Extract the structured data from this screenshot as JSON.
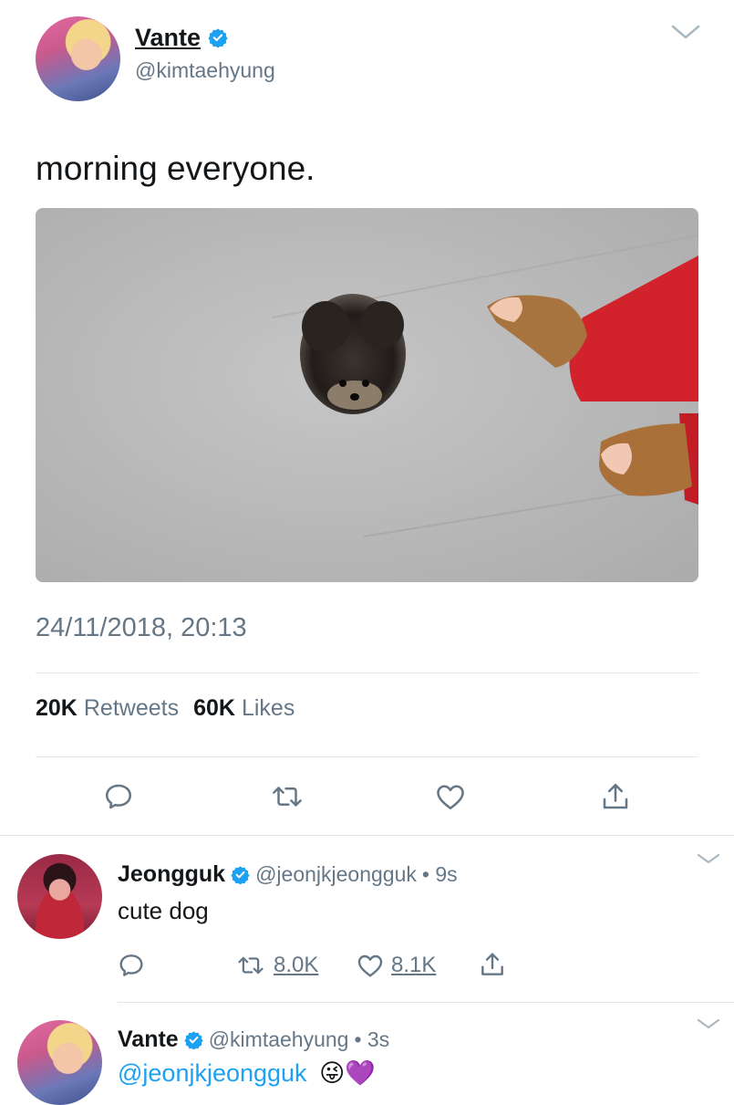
{
  "tweet": {
    "author_name": "Vante",
    "author_handle": "@kimtaehyung",
    "text": "morning everyone.",
    "timestamp": "24/11/2018, 20:13",
    "retweets_count": "20K",
    "retweets_label": "Retweets",
    "likes_count": "60K",
    "likes_label": "Likes"
  },
  "replies": [
    {
      "author_name": "Jeongguk",
      "author_handle": "@jeonjkjeongguk",
      "time": "• 9s",
      "text": "cute dog",
      "retweets": "8.0K",
      "likes": "8.1K"
    },
    {
      "author_name": "Vante",
      "author_handle": "@kimtaehyung",
      "time": "• 3s",
      "mention": "@jeonjkjeongguk",
      "emojis": "😜💜"
    }
  ],
  "colors": {
    "verified": "#1da1f2",
    "link": "#1da1f2",
    "muted": "#657786"
  },
  "icons": [
    "chevron-down-icon",
    "verified-icon",
    "reply-icon",
    "retweet-icon",
    "like-icon",
    "share-icon"
  ]
}
